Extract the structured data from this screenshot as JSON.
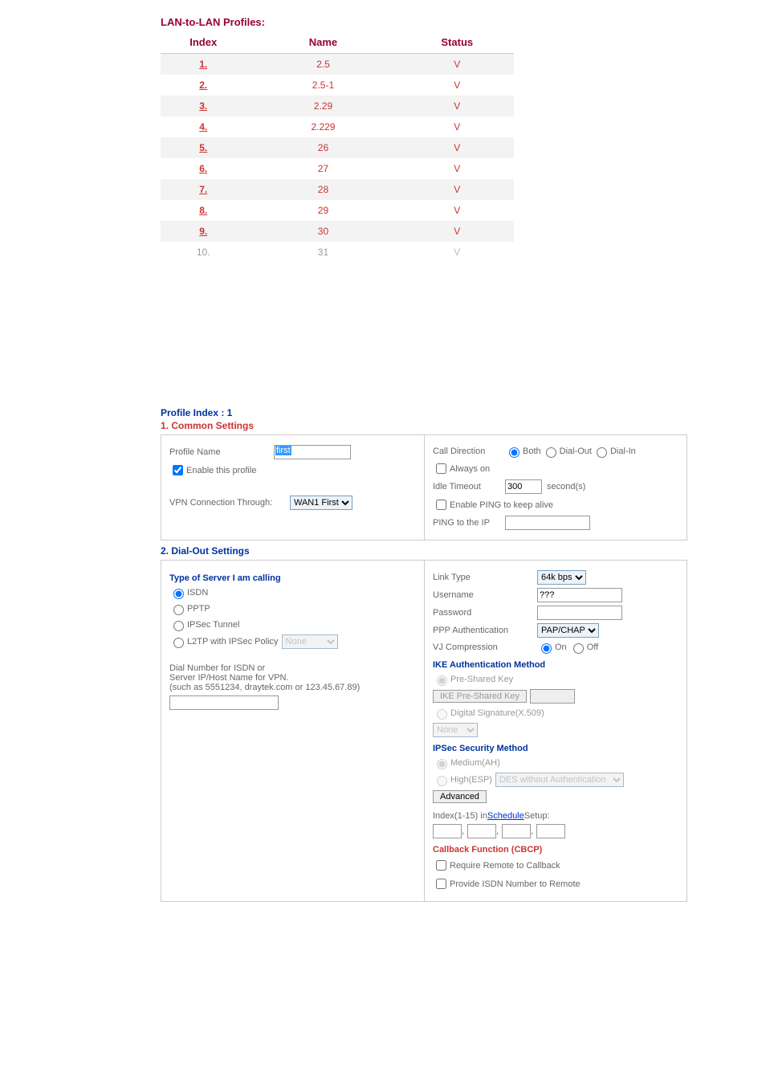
{
  "profiles_table": {
    "title": "LAN-to-LAN Profiles:",
    "headers": {
      "index": "Index",
      "name": "Name",
      "status": "Status"
    },
    "rows": [
      {
        "index": "1.",
        "name": "2.5",
        "status": "V",
        "enabled": true
      },
      {
        "index": "2.",
        "name": "2.5-1",
        "status": "V",
        "enabled": true
      },
      {
        "index": "3.",
        "name": "2.29",
        "status": "V",
        "enabled": true
      },
      {
        "index": "4.",
        "name": "2.229",
        "status": "V",
        "enabled": true
      },
      {
        "index": "5.",
        "name": "26",
        "status": "V",
        "enabled": true
      },
      {
        "index": "6.",
        "name": "27",
        "status": "V",
        "enabled": true
      },
      {
        "index": "7.",
        "name": "28",
        "status": "V",
        "enabled": true
      },
      {
        "index": "8.",
        "name": "29",
        "status": "V",
        "enabled": true
      },
      {
        "index": "9.",
        "name": "30",
        "status": "V",
        "enabled": true
      },
      {
        "index": "10.",
        "name": "31",
        "status": "V",
        "enabled": false
      }
    ]
  },
  "profile_index_label": "Profile Index : 1",
  "common": {
    "header": "1. Common Settings",
    "profile_name_label": "Profile Name",
    "profile_name_value": "first",
    "enable_profile_label": "Enable this profile",
    "vpn_conn_through_label": "VPN Connection Through:",
    "vpn_conn_through_value": "WAN1 First",
    "call_direction_label": "Call Direction",
    "both_label": "Both",
    "dial_out_label": "Dial-Out",
    "dial_in_label": "Dial-In",
    "always_on_label": "Always on",
    "idle_timeout_label": "Idle Timeout",
    "idle_timeout_value": "300",
    "seconds_label": "second(s)",
    "enable_ping_label": "Enable PING to keep alive",
    "ping_ip_label": "PING to the IP",
    "ping_ip_value": ""
  },
  "dialout": {
    "header": "2. Dial-Out Settings",
    "type_header": "Type of Server I am calling",
    "isdn_label": "ISDN",
    "pptp_label": "PPTP",
    "ipsec_tunnel_label": "IPSec Tunnel",
    "l2tp_label": "L2TP with IPSec Policy",
    "l2tp_policy_value": "None",
    "dial_number_label": "Dial Number for ISDN or\nServer IP/Host Name for VPN.\n(such as 5551234, draytek.com or 123.45.67.89)",
    "dial_number_value": "",
    "link_type_label": "Link Type",
    "link_type_value": "64k bps",
    "username_label": "Username",
    "username_value": "???",
    "password_label": "Password",
    "password_value": "",
    "ppp_auth_label": "PPP Authentication",
    "ppp_auth_value": "PAP/CHAP",
    "vj_label": "VJ Compression",
    "vj_on_label": "On",
    "vj_off_label": "Off",
    "ike_header": "IKE Authentication Method",
    "psk_label": "Pre-Shared Key",
    "ike_psk_btn": "IKE Pre-Shared Key",
    "digsig_label": "Digital Signature(X.509)",
    "digsig_value": "None",
    "ipsec_sec_header": "IPSec Security Method",
    "medium_label": "Medium(AH)",
    "high_label": "High(ESP)",
    "high_value": "DES without Authentication",
    "advanced_btn": "Advanced",
    "schedule_prefix": "Index(1-15) in ",
    "schedule_link": "Schedule",
    "schedule_suffix": " Setup:",
    "cbcp_header": "Callback Function (CBCP)",
    "cbcp_require_label": "Require Remote to Callback",
    "cbcp_provide_label": "Provide ISDN Number to Remote"
  }
}
